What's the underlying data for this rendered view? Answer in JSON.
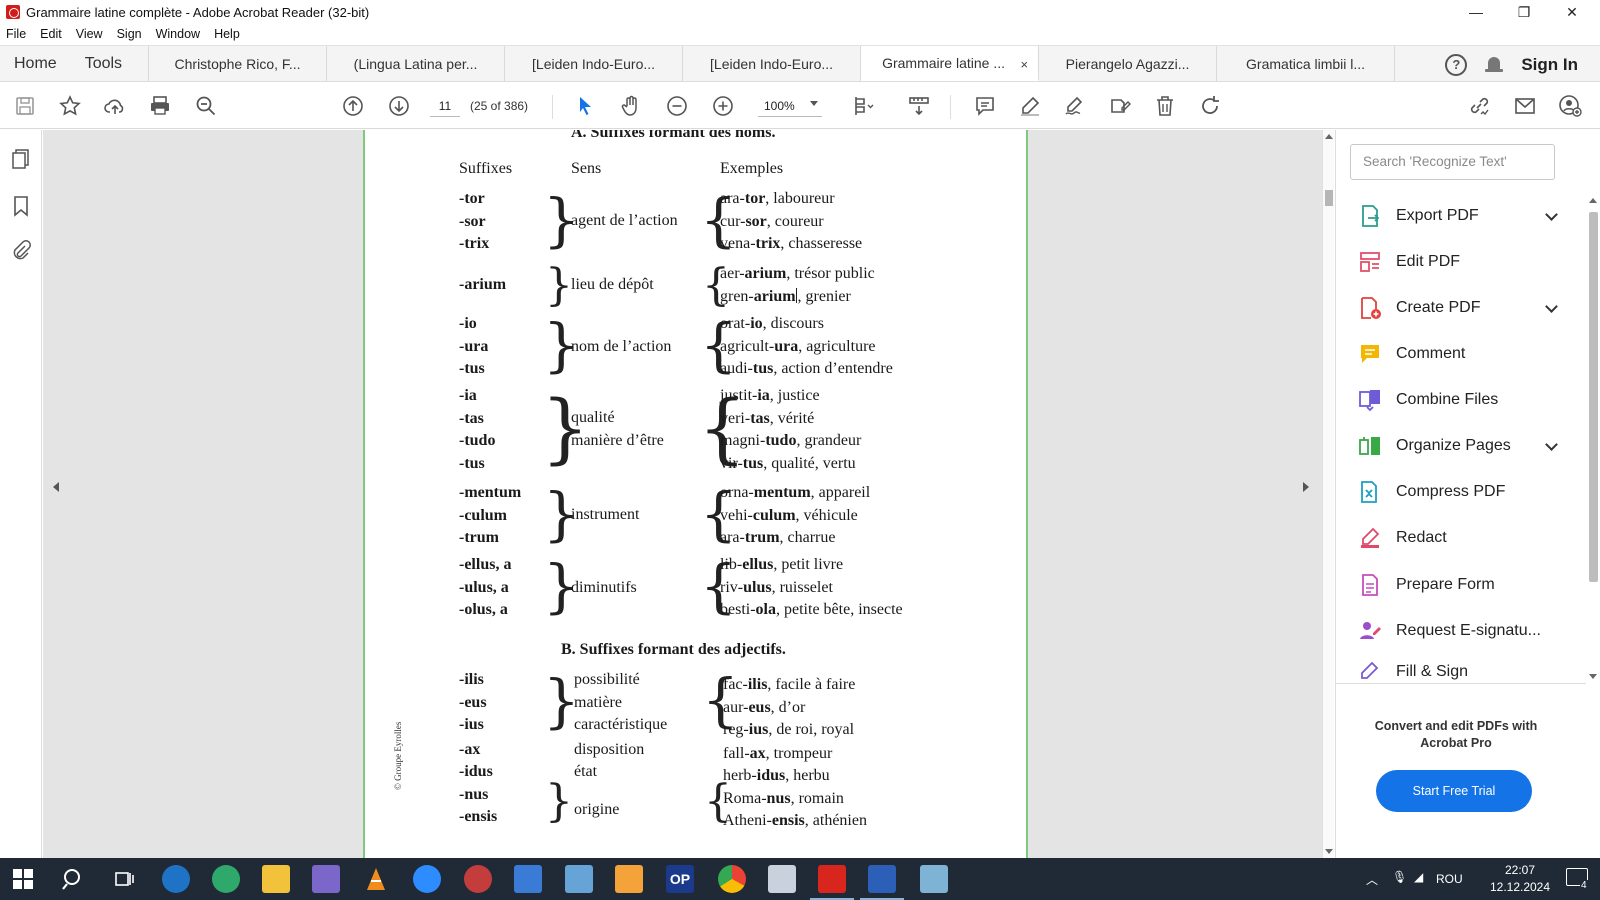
{
  "window": {
    "title": "Grammaire latine complète - Adobe Acrobat Reader (32-bit)",
    "minimize": "—",
    "restore": "❐",
    "close": "✕"
  },
  "menu": [
    "File",
    "Edit",
    "View",
    "Sign",
    "Window",
    "Help"
  ],
  "tabs": {
    "home": "Home",
    "tools": "Tools",
    "docs": [
      "Christophe Rico, F...",
      "(Lingua Latina per...",
      "[Leiden Indo-Euro...",
      "[Leiden Indo-Euro...",
      "Grammaire latine ...",
      "Pierangelo Agazzi...",
      "Gramatica limbii l..."
    ],
    "active_index": 4,
    "close_glyph": "×",
    "help_glyph": "?",
    "sign_in": "Sign In"
  },
  "toolbar": {
    "page_number": "11",
    "page_count": "(25 of 386)",
    "zoom": "100%"
  },
  "page": {
    "section_a": "A. Suffixes formant des noms.",
    "headers": [
      "Suffixes",
      "Sens",
      "Exemples"
    ],
    "section_b": "B. Suffixes formant des adjectifs.",
    "copyright": "© Groupe Eyrolles",
    "groups_a": [
      {
        "suffixes": [
          "-tor",
          "-sor",
          "-trix"
        ],
        "sens": [
          "agent de l’action"
        ],
        "examples": [
          [
            "ara-",
            "tor",
            ", laboureur"
          ],
          [
            "cur-",
            "sor",
            ", coureur"
          ],
          [
            "vena-",
            "trix",
            ", chasseresse"
          ]
        ]
      },
      {
        "suffixes": [
          "-arium"
        ],
        "sens": [
          "lieu de dépôt"
        ],
        "examples": [
          [
            "aer-",
            "arium",
            ", trésor public"
          ],
          [
            "gren-",
            "arium",
            ", grenier"
          ]
        ]
      },
      {
        "suffixes": [
          "-io",
          "-ura",
          "-tus"
        ],
        "sens": [
          "nom de l’action"
        ],
        "examples": [
          [
            "orat-",
            "io",
            ", discours"
          ],
          [
            "agricult-",
            "ura",
            ", agriculture"
          ],
          [
            "audi-",
            "tus",
            ", action d’entendre"
          ]
        ]
      },
      {
        "suffixes": [
          "-ia",
          "-tas",
          "-tudo",
          "-tus"
        ],
        "sens": [
          "qualité",
          "manière d’être"
        ],
        "examples": [
          [
            "justit-",
            "ia",
            ", justice"
          ],
          [
            "veri-",
            "tas",
            ", vérité"
          ],
          [
            "magni-",
            "tudo",
            ", grandeur"
          ],
          [
            "vir-",
            "tus",
            ", qualité, vertu"
          ]
        ]
      },
      {
        "suffixes": [
          "-mentum",
          "-culum",
          "-trum"
        ],
        "sens": [
          "instrument"
        ],
        "examples": [
          [
            "orna-",
            "mentum",
            ", appareil"
          ],
          [
            "vehi-",
            "culum",
            ", véhicule"
          ],
          [
            "ara-",
            "trum",
            ", charrue"
          ]
        ]
      },
      {
        "suffixes": [
          "-ellus, a",
          "-ulus, a",
          "-olus, a"
        ],
        "sens": [
          "diminutifs"
        ],
        "examples": [
          [
            "lib-",
            "ellus",
            ", petit livre"
          ],
          [
            "riv-",
            "ulus",
            ", ruisselet"
          ],
          [
            "besti-",
            "ola",
            ", petite bête, insecte"
          ]
        ]
      }
    ],
    "groups_b_suffixes": [
      "-ilis",
      "-eus",
      "-ius",
      "-ax",
      "-idus",
      "-nus",
      "-ensis"
    ],
    "groups_b_sens": [
      "possibilité",
      "matière",
      "caractéristique",
      "disposition",
      "état",
      "origine"
    ],
    "groups_b_examples": [
      [
        "fac-",
        "ilis",
        ", facile à faire"
      ],
      [
        "aur-",
        "eus",
        ", d’or"
      ],
      [
        "reg-",
        "ius",
        ", de roi, royal"
      ],
      [
        "fall-",
        "ax",
        ", trompeur"
      ],
      [
        "herb-",
        "idus",
        ", herbu"
      ],
      [
        "Roma-",
        "nus",
        ", romain"
      ],
      [
        "Atheni-",
        "ensis",
        ", athénien"
      ]
    ]
  },
  "right_panel": {
    "search_placeholder": "Search 'Recognize Text'",
    "tools": [
      {
        "label": "Export PDF",
        "icon": "export-pdf-icon",
        "color": "#2a9d8f",
        "chevron": true
      },
      {
        "label": "Edit PDF",
        "icon": "edit-pdf-icon",
        "color": "#e4506a",
        "chevron": false
      },
      {
        "label": "Create PDF",
        "icon": "create-pdf-icon",
        "color": "#e0443d",
        "chevron": true
      },
      {
        "label": "Comment",
        "icon": "comment-icon",
        "color": "#f2b705",
        "chevron": false
      },
      {
        "label": "Combine Files",
        "icon": "combine-files-icon",
        "color": "#6e5bd6",
        "chevron": false
      },
      {
        "label": "Organize Pages",
        "icon": "organize-pages-icon",
        "color": "#3aa845",
        "chevron": true
      },
      {
        "label": "Compress PDF",
        "icon": "compress-pdf-icon",
        "color": "#1f9ec4",
        "chevron": false
      },
      {
        "label": "Redact",
        "icon": "redact-icon",
        "color": "#e04a6a",
        "chevron": false
      },
      {
        "label": "Prepare Form",
        "icon": "prepare-form-icon",
        "color": "#c64fb9",
        "chevron": false
      },
      {
        "label": "Request E-signatu...",
        "icon": "request-esign-icon",
        "color": "#9b4dca",
        "chevron": false
      },
      {
        "label": "Fill & Sign",
        "icon": "fill-sign-icon",
        "color": "#7b5ad6",
        "chevron": false
      }
    ],
    "promo": "Convert and edit PDFs with Acrobat Pro",
    "trial_button": "Start Free Trial"
  },
  "taskbar": {
    "language": "ROU",
    "time": "22:07",
    "date": "12.12.2024",
    "notifications": "4",
    "apps": [
      "start-icon",
      "search-icon",
      "task-view-icon",
      "internet-explorer-icon",
      "edge-icon",
      "file-explorer-icon",
      "app-icon",
      "vlc-icon",
      "zoom-icon",
      "app-icon-red",
      "save-icon",
      "network-icon",
      "media-player-icon",
      "op-icon",
      "chrome-icon",
      "app-icon-gray",
      "acrobat-icon",
      "word-icon",
      "notepad-icon"
    ],
    "op_label": "OP"
  }
}
